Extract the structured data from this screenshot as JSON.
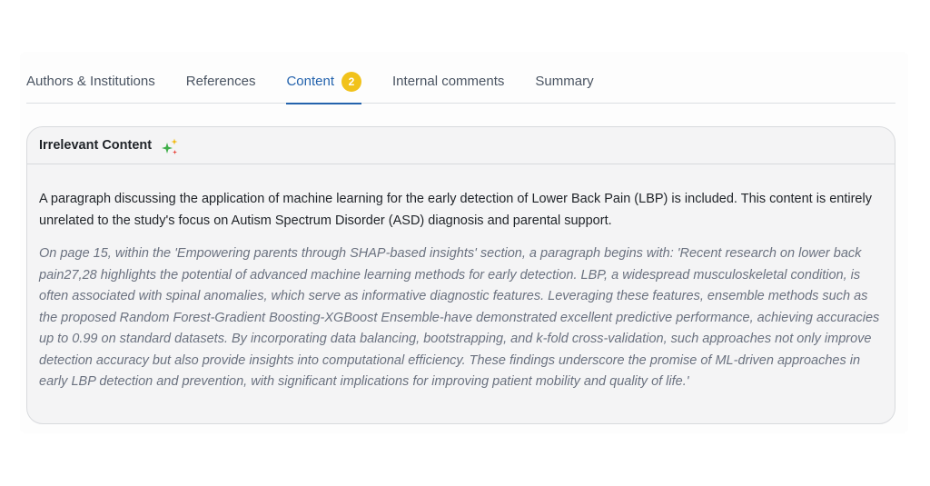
{
  "tabs": [
    {
      "label": "Authors & Institutions",
      "active": false
    },
    {
      "label": "References",
      "active": false
    },
    {
      "label": "Content",
      "active": true,
      "badge": "2"
    },
    {
      "label": "Internal comments",
      "active": false
    },
    {
      "label": "Summary",
      "active": false
    }
  ],
  "card": {
    "title": "Irrelevant Content",
    "icon": "sparkle-icon",
    "summary": "A paragraph discussing the application of machine learning for the early detection of Lower Back Pain (LBP) is included. This content is entirely unrelated to the study's focus on Autism Spectrum Disorder (ASD) diagnosis and parental support.",
    "quote": "On page 15, within the 'Empowering parents through SHAP-based insights' section, a paragraph begins with: 'Recent research on lower back pain27,28 highlights the potential of advanced machine learning methods for early detection. LBP, a widespread musculoskeletal condition, is often associated with spinal anomalies, which serve as informative diagnostic features. Leveraging these features, ensemble methods such as the proposed Random Forest-Gradient Boosting-XGBoost Ensemble-have demonstrated excellent predictive performance, achieving accuracies up to 0.99 on standard datasets. By incorporating data balancing, bootstrapping, and k-fold cross-validation, such approaches not only improve detection accuracy but also provide insights into computational efficiency. These findings underscore the promise of ML-driven approaches in early LBP detection and prevention, with significant implications for improving patient mobility and quality of life.'"
  },
  "colors": {
    "accent": "#2463ad",
    "badge": "#f1c21b",
    "card_background": "#f4f4f5",
    "muted_text": "#6b7280"
  }
}
